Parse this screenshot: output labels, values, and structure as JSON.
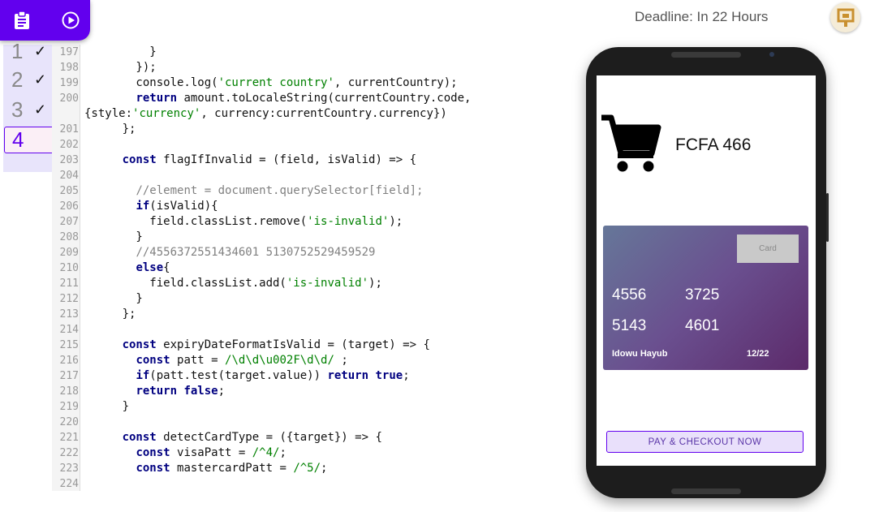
{
  "toolbar": {
    "brief_icon": "clipboard-icon",
    "run_icon": "play-circle-icon"
  },
  "steps": [
    {
      "label": "1",
      "done": true
    },
    {
      "label": "2",
      "done": true
    },
    {
      "label": "3",
      "done": true
    },
    {
      "label": "4",
      "done": false,
      "active": true
    }
  ],
  "code_lines": [
    {
      "n": "197",
      "html": "          }"
    },
    {
      "n": "198",
      "html": "        });"
    },
    {
      "n": "199",
      "html": "        console.log(<span class=\"str\">'current country'</span>, currentCountry);"
    },
    {
      "n": "200",
      "html": "        <span class=\"kw\">return</span> amount.toLocaleString(currentCountry.code,"
    },
    {
      "n": "",
      "html": "{style:<span class=\"str\">'currency'</span>, currency:currentCountry.currency})"
    },
    {
      "n": "201",
      "html": "      };"
    },
    {
      "n": "202",
      "html": ""
    },
    {
      "n": "203",
      "html": "      <span class=\"kw\">const</span> flagIfInvalid = (field, isValid) => {"
    },
    {
      "n": "204",
      "html": ""
    },
    {
      "n": "205",
      "html": "        <span class=\"com\">//element = document.querySelector[field];</span>"
    },
    {
      "n": "206",
      "html": "        <span class=\"kw\">if</span>(isValid){"
    },
    {
      "n": "207",
      "html": "          field.classList.remove(<span class=\"str\">'is-invalid'</span>);"
    },
    {
      "n": "208",
      "html": "        }"
    },
    {
      "n": "209",
      "html": "        <span class=\"com\">//4556372551434601 5130752529459529</span>"
    },
    {
      "n": "210",
      "html": "        <span class=\"kw\">else</span>{"
    },
    {
      "n": "211",
      "html": "          field.classList.add(<span class=\"str\">'is-invalid'</span>);"
    },
    {
      "n": "212",
      "html": "        }"
    },
    {
      "n": "213",
      "html": "      };"
    },
    {
      "n": "214",
      "html": ""
    },
    {
      "n": "215",
      "html": "      <span class=\"kw\">const</span> expiryDateFormatIsValid = (target) => {"
    },
    {
      "n": "216",
      "html": "        <span class=\"kw\">const</span> patt = <span class=\"str\">/\\d\\d\\u002F\\d\\d/</span> ;"
    },
    {
      "n": "217",
      "html": "        <span class=\"kw\">if</span>(patt.test(target.value)) <span class=\"kw\">return</span> <span class=\"kw\">true</span>;"
    },
    {
      "n": "218",
      "html": "        <span class=\"kw\">return</span> <span class=\"kw\">false</span>;"
    },
    {
      "n": "219",
      "html": "      }"
    },
    {
      "n": "220",
      "html": ""
    },
    {
      "n": "221",
      "html": "      <span class=\"kw\">const</span> detectCardType = ({target}) => {"
    },
    {
      "n": "222",
      "html": "        <span class=\"kw\">const</span> visaPatt = <span class=\"str\">/^4/</span>;"
    },
    {
      "n": "223",
      "html": "        <span class=\"kw\">const</span> mastercardPatt = <span class=\"str\">/^5/</span>;"
    },
    {
      "n": "224",
      "html": ""
    }
  ],
  "header": {
    "deadline": "Deadline: In 22 Hours",
    "avatar_icon": "user-avatar-icon"
  },
  "phone": {
    "cart_icon": "shopping-cart-icon",
    "price": "FCFA 466",
    "card": {
      "type_label": "Card",
      "number_groups": [
        "4556",
        "3725",
        "5143",
        "4601"
      ],
      "holder": "Idowu Hayub",
      "expiry": "12/22"
    },
    "pay_button": "PAY & CHECKOUT NOW"
  },
  "colors": {
    "accent": "#6200ee",
    "step_bg": "#e8e4fb",
    "keyword": "#000080",
    "string": "#008000",
    "comment": "#808080"
  }
}
